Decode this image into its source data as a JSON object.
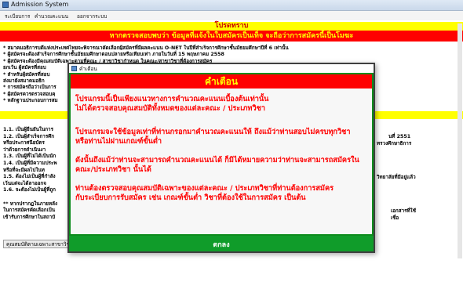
{
  "window": {
    "title": "Admission System"
  },
  "menu": [
    "ระเบียบการ",
    "คำนวณคะแนน",
    "ออกจากระบบ"
  ],
  "notice": {
    "header": "โปรดทราบ",
    "warning": "หากตรวจสอบพบว่า ข้อมูลที่แจ้งในใบสมัครเป็นเท็จ จะถือว่าการสมัครนี้เป็นโมฆะ",
    "bullets": [
      "* สมาคมอธิการบดีแห่งประเทศไทยจะพิจารณาคัดเลือกผู้สมัครที่มีผลคะแนน O-NET ในปีที่สำเร็จการศึกษาชั้นมัธยมศึกษาปีที่ 6 เท่านั้น",
      "* ผู้สมัครจะต้องสำเร็จการศึกษาชั้นมัธยมศึกษาตอนปลายหรือเทียบเท่า ภายในวันที่ 15 พฤษภาคม 2558",
      "* ผู้สมัครจะต้องมีคุณสมบัติเฉพาะตามที่คณะ / สาขาวิชากำหนด ในคณะ/สาขาวิชาที่ต้องการสมัคร",
      "   ยกเว้น ผู้สมัครที่สอบ",
      "* สำหรับผู้สมัครที่สอบ",
      "   ส่งมายังสมาคมอธิก",
      "* การสมัครถือว่าเป็นการ",
      "* ผู้สมัครควรตรวจสอบคุ",
      "* หลักฐานประกอบการสม"
    ]
  },
  "section": {
    "header": "",
    "items": [
      "1.1. เป็นผู้ยืนยันในการ",
      "1.2. เป็นผู้สำเร็จการศึก",
      "      หรือประกาศนียบัตร",
      "      ว่าด้วยการดำเนินงา",
      "1.3. เป็นผู้ที่ไม่ได้เป็นนัก",
      "1.4. เป็นผู้ที่มีความประพ",
      "      หรือที่จะมีผลไปในท",
      "1.5. ต้องไม่เป็นผู้ที่กำลัง",
      "      เว้นแต่จะได้ลาออกจ",
      "1.6. จะต้องไม่เป็นผู้ที่ถูก",
      "",
      "** หากปรากฏในภายหลัง",
      "ในการสมัครคัดเลือกเป็น",
      "เข้ารับการศึกษาในสถาบั"
    ],
    "right_fragments": [
      "นที่ 2551",
      "ทรวงศึกษาธิการ",
      "วิทยาลัยที่มีอยู่แล้ว",
      "เอกสารที่ใช้",
      "เชื่อ"
    ]
  },
  "bottom_button": "คุณสมบัติตามเฉพาะสาขาวิชา",
  "dialog": {
    "title": "คำเตือน",
    "header": "คำเตือน",
    "lines": [
      "โปรแกรมนี้เป็นเพียงแนวทางการคำนวณคะแนนเบื้องต้นเท่านั้น",
      "ไม่ได้ตรวจสอบคุณสมบัติทั้งหมดของแต่ละคณะ / ประเภทวิชา",
      "",
      "โปรแกรมจะใช้ข้อมูลเท่าที่ท่านกรอกมาคำนวณคะแนนให้   ถึงแม้ว่าท่านสอบไม่ครบทุกวิชา",
      "หรือท่านไม่ผ่านเกณฑ์ขั้นต่ำ",
      "",
      "ดังนั้นถึงแม้ว่าท่านจะสามารถคำนวณคะแนนได้ ก็มิได้หมายความว่าท่านจะสามารถสมัครใน",
      "คณะ/ประเภทวิชา  นั้นได้",
      "",
      "ท่านต้องตรวจสอบคุณสมบัติเฉพาะของแต่ละคณะ / ประเภทวิชาที่ท่านต้องการสมัคร",
      "กับระเบียบการรับสมัคร เช่น เกณฑ์ขั้นต่ำ วิชาที่ต้องใช้ในการสมัคร เป็นต้น"
    ],
    "ok_label": "ตกลง"
  }
}
